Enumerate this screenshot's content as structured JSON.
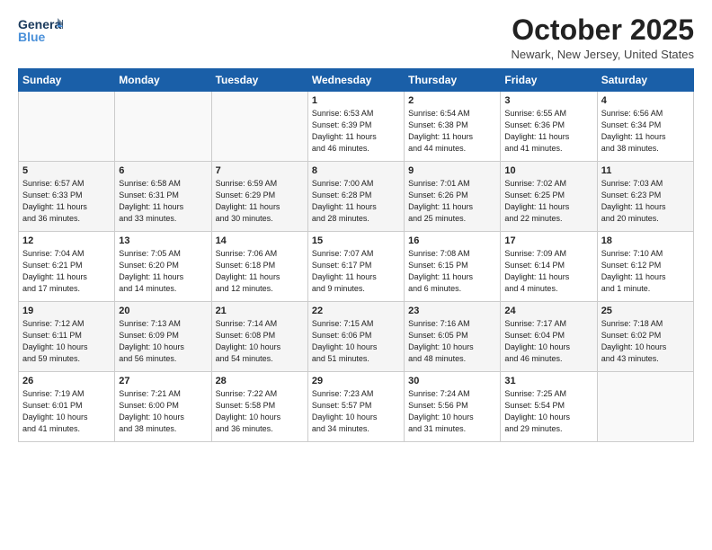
{
  "logo": {
    "line1": "General",
    "line2": "Blue"
  },
  "header": {
    "month": "October 2025",
    "location": "Newark, New Jersey, United States"
  },
  "weekdays": [
    "Sunday",
    "Monday",
    "Tuesday",
    "Wednesday",
    "Thursday",
    "Friday",
    "Saturday"
  ],
  "weeks": [
    [
      {
        "num": "",
        "info": ""
      },
      {
        "num": "",
        "info": ""
      },
      {
        "num": "",
        "info": ""
      },
      {
        "num": "1",
        "info": "Sunrise: 6:53 AM\nSunset: 6:39 PM\nDaylight: 11 hours\nand 46 minutes."
      },
      {
        "num": "2",
        "info": "Sunrise: 6:54 AM\nSunset: 6:38 PM\nDaylight: 11 hours\nand 44 minutes."
      },
      {
        "num": "3",
        "info": "Sunrise: 6:55 AM\nSunset: 6:36 PM\nDaylight: 11 hours\nand 41 minutes."
      },
      {
        "num": "4",
        "info": "Sunrise: 6:56 AM\nSunset: 6:34 PM\nDaylight: 11 hours\nand 38 minutes."
      }
    ],
    [
      {
        "num": "5",
        "info": "Sunrise: 6:57 AM\nSunset: 6:33 PM\nDaylight: 11 hours\nand 36 minutes."
      },
      {
        "num": "6",
        "info": "Sunrise: 6:58 AM\nSunset: 6:31 PM\nDaylight: 11 hours\nand 33 minutes."
      },
      {
        "num": "7",
        "info": "Sunrise: 6:59 AM\nSunset: 6:29 PM\nDaylight: 11 hours\nand 30 minutes."
      },
      {
        "num": "8",
        "info": "Sunrise: 7:00 AM\nSunset: 6:28 PM\nDaylight: 11 hours\nand 28 minutes."
      },
      {
        "num": "9",
        "info": "Sunrise: 7:01 AM\nSunset: 6:26 PM\nDaylight: 11 hours\nand 25 minutes."
      },
      {
        "num": "10",
        "info": "Sunrise: 7:02 AM\nSunset: 6:25 PM\nDaylight: 11 hours\nand 22 minutes."
      },
      {
        "num": "11",
        "info": "Sunrise: 7:03 AM\nSunset: 6:23 PM\nDaylight: 11 hours\nand 20 minutes."
      }
    ],
    [
      {
        "num": "12",
        "info": "Sunrise: 7:04 AM\nSunset: 6:21 PM\nDaylight: 11 hours\nand 17 minutes."
      },
      {
        "num": "13",
        "info": "Sunrise: 7:05 AM\nSunset: 6:20 PM\nDaylight: 11 hours\nand 14 minutes."
      },
      {
        "num": "14",
        "info": "Sunrise: 7:06 AM\nSunset: 6:18 PM\nDaylight: 11 hours\nand 12 minutes."
      },
      {
        "num": "15",
        "info": "Sunrise: 7:07 AM\nSunset: 6:17 PM\nDaylight: 11 hours\nand 9 minutes."
      },
      {
        "num": "16",
        "info": "Sunrise: 7:08 AM\nSunset: 6:15 PM\nDaylight: 11 hours\nand 6 minutes."
      },
      {
        "num": "17",
        "info": "Sunrise: 7:09 AM\nSunset: 6:14 PM\nDaylight: 11 hours\nand 4 minutes."
      },
      {
        "num": "18",
        "info": "Sunrise: 7:10 AM\nSunset: 6:12 PM\nDaylight: 11 hours\nand 1 minute."
      }
    ],
    [
      {
        "num": "19",
        "info": "Sunrise: 7:12 AM\nSunset: 6:11 PM\nDaylight: 10 hours\nand 59 minutes."
      },
      {
        "num": "20",
        "info": "Sunrise: 7:13 AM\nSunset: 6:09 PM\nDaylight: 10 hours\nand 56 minutes."
      },
      {
        "num": "21",
        "info": "Sunrise: 7:14 AM\nSunset: 6:08 PM\nDaylight: 10 hours\nand 54 minutes."
      },
      {
        "num": "22",
        "info": "Sunrise: 7:15 AM\nSunset: 6:06 PM\nDaylight: 10 hours\nand 51 minutes."
      },
      {
        "num": "23",
        "info": "Sunrise: 7:16 AM\nSunset: 6:05 PM\nDaylight: 10 hours\nand 48 minutes."
      },
      {
        "num": "24",
        "info": "Sunrise: 7:17 AM\nSunset: 6:04 PM\nDaylight: 10 hours\nand 46 minutes."
      },
      {
        "num": "25",
        "info": "Sunrise: 7:18 AM\nSunset: 6:02 PM\nDaylight: 10 hours\nand 43 minutes."
      }
    ],
    [
      {
        "num": "26",
        "info": "Sunrise: 7:19 AM\nSunset: 6:01 PM\nDaylight: 10 hours\nand 41 minutes."
      },
      {
        "num": "27",
        "info": "Sunrise: 7:21 AM\nSunset: 6:00 PM\nDaylight: 10 hours\nand 38 minutes."
      },
      {
        "num": "28",
        "info": "Sunrise: 7:22 AM\nSunset: 5:58 PM\nDaylight: 10 hours\nand 36 minutes."
      },
      {
        "num": "29",
        "info": "Sunrise: 7:23 AM\nSunset: 5:57 PM\nDaylight: 10 hours\nand 34 minutes."
      },
      {
        "num": "30",
        "info": "Sunrise: 7:24 AM\nSunset: 5:56 PM\nDaylight: 10 hours\nand 31 minutes."
      },
      {
        "num": "31",
        "info": "Sunrise: 7:25 AM\nSunset: 5:54 PM\nDaylight: 10 hours\nand 29 minutes."
      },
      {
        "num": "",
        "info": ""
      }
    ]
  ]
}
